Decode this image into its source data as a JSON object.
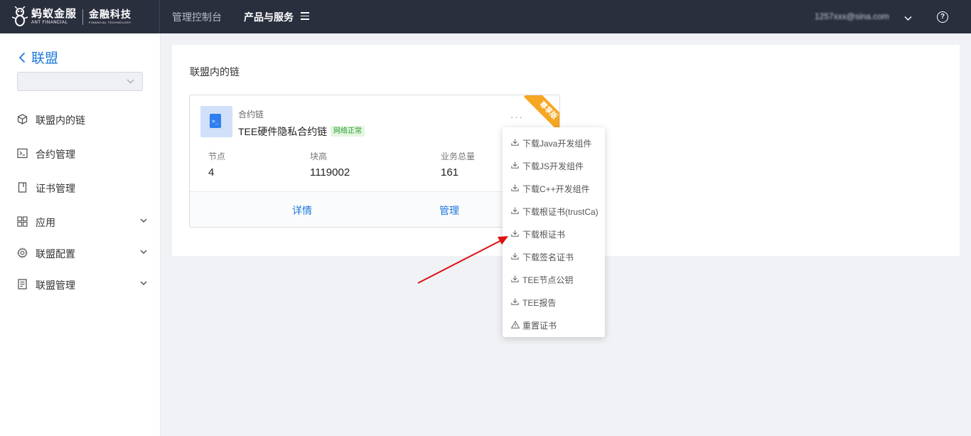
{
  "header": {
    "logo_cn": "蚂蚁金服",
    "logo_en": "ANT FINANCIAL",
    "logo2_cn": "金融科技",
    "logo2_en": "FINANCIAL TECHNOLOGY",
    "nav_console": "管理控制台",
    "nav_products": "产品与服务",
    "account": "1257xxx@sina.com"
  },
  "sidebar": {
    "back_label": "联盟",
    "select_value": "",
    "items": [
      {
        "label": "联盟内的链",
        "icon": "cube-icon"
      },
      {
        "label": "合约管理",
        "icon": "terminal-icon"
      },
      {
        "label": "证书管理",
        "icon": "certificate-icon"
      },
      {
        "label": "应用",
        "icon": "grid-icon",
        "expandable": true
      },
      {
        "label": "联盟配置",
        "icon": "gear-icon",
        "expandable": true
      },
      {
        "label": "联盟管理",
        "icon": "list-icon",
        "expandable": true
      }
    ]
  },
  "main": {
    "section_title": "联盟内的链",
    "card": {
      "type": "合约链",
      "name": "TEE硬件隐私合约链",
      "status": "网络正常",
      "ribbon": "尊享版",
      "more": "···",
      "stats": [
        {
          "label": "节点",
          "value": "4"
        },
        {
          "label": "块高",
          "value": "1119002"
        },
        {
          "label": "业务总量",
          "value": "161"
        }
      ],
      "actions": {
        "details": "详情",
        "manage": "管理"
      }
    }
  },
  "dropdown": {
    "items": [
      {
        "label": "下载Java开发组件",
        "icon": "download-icon"
      },
      {
        "label": "下载JS开发组件",
        "icon": "download-icon"
      },
      {
        "label": "下载C++开发组件",
        "icon": "download-icon"
      },
      {
        "label": "下载根证书(trustCa)",
        "icon": "download-icon"
      },
      {
        "label": "下载根证书",
        "icon": "download-icon"
      },
      {
        "label": "下载签名证书",
        "icon": "download-icon"
      },
      {
        "label": "TEE节点公钥",
        "icon": "download-icon"
      },
      {
        "label": "TEE报告",
        "icon": "download-icon"
      },
      {
        "label": "重置证书",
        "icon": "warning-icon"
      }
    ]
  },
  "colors": {
    "topbar": "#2a2f3e",
    "accent": "#1e78dc",
    "ribbon": "#f5a623",
    "status_green": "#2e9e34",
    "annotation_arrow": "#e01010"
  }
}
